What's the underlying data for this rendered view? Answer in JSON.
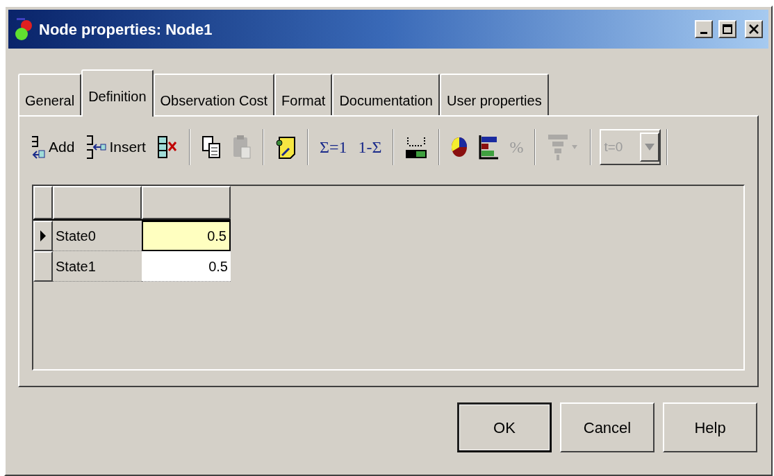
{
  "window": {
    "title": "Node properties: Node1"
  },
  "tabs": [
    {
      "label": "General",
      "selected": false
    },
    {
      "label": "Definition",
      "selected": true
    },
    {
      "label": "Observation Cost",
      "selected": false
    },
    {
      "label": "Format",
      "selected": false
    },
    {
      "label": "Documentation",
      "selected": false
    },
    {
      "label": "User properties",
      "selected": false
    }
  ],
  "toolbar": [
    {
      "kind": "add",
      "label": "Add",
      "disabled": false
    },
    {
      "kind": "insert",
      "label": "Insert",
      "disabled": false
    },
    {
      "kind": "delete",
      "disabled": false
    },
    {
      "kind": "separator"
    },
    {
      "kind": "copy",
      "disabled": false
    },
    {
      "kind": "paste",
      "disabled": true
    },
    {
      "kind": "separator"
    },
    {
      "kind": "edit",
      "disabled": false
    },
    {
      "kind": "separator"
    },
    {
      "kind": "text",
      "label": "Σ=1",
      "disabled": false
    },
    {
      "kind": "text",
      "label": "1-Σ",
      "disabled": false
    },
    {
      "kind": "separator"
    },
    {
      "kind": "range",
      "disabled": false
    },
    {
      "kind": "separator"
    },
    {
      "kind": "pie",
      "disabled": false
    },
    {
      "kind": "bars",
      "disabled": false
    },
    {
      "kind": "text",
      "label": "%",
      "disabled": true
    },
    {
      "kind": "separator"
    },
    {
      "kind": "tree",
      "disabled": true
    },
    {
      "kind": "separator"
    },
    {
      "kind": "combo",
      "value": "t=0",
      "disabled": true
    },
    {
      "kind": "separator"
    }
  ],
  "grid": {
    "rows": [
      {
        "state": "State0",
        "value": "0.5",
        "selected": true
      },
      {
        "state": "State1",
        "value": "0.5",
        "selected": false
      }
    ]
  },
  "buttons": [
    {
      "label": "OK",
      "default": true
    },
    {
      "label": "Cancel",
      "default": false
    },
    {
      "label": "Help",
      "default": false
    }
  ]
}
